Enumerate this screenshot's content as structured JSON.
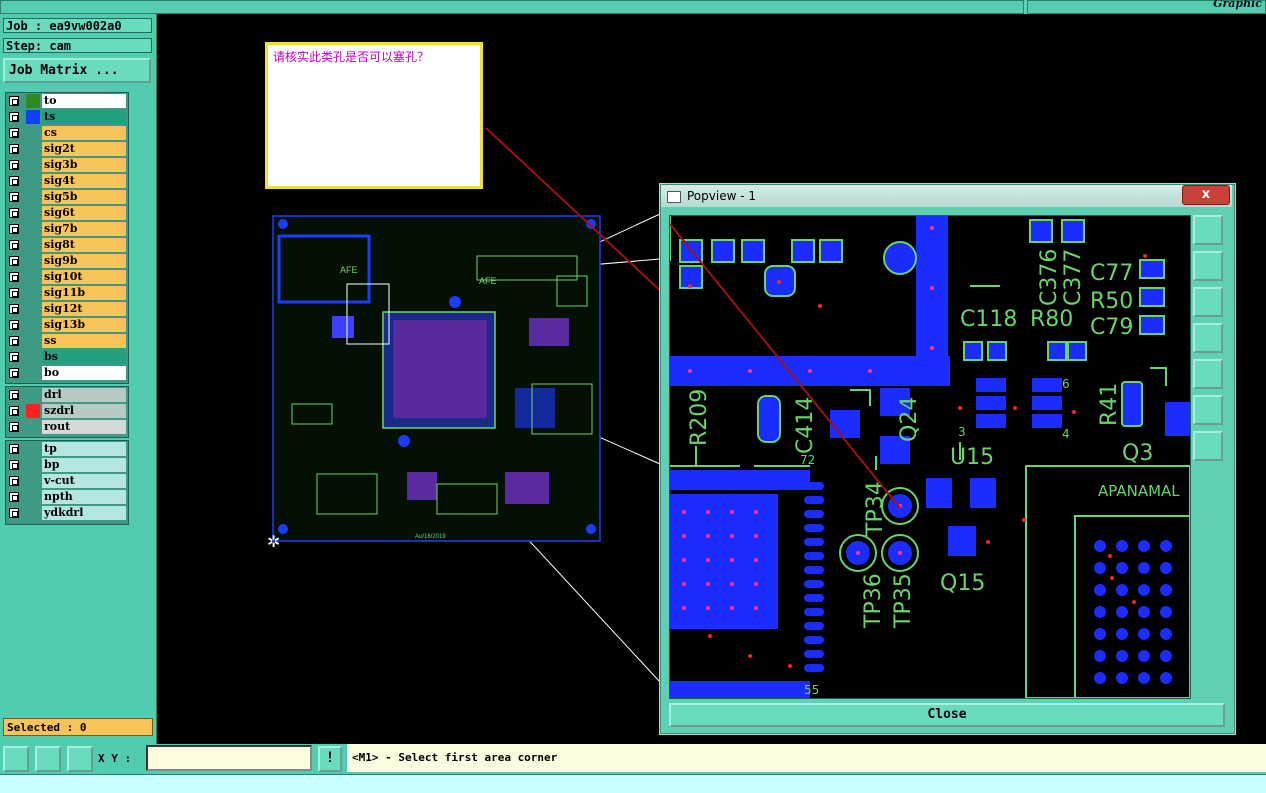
{
  "topbar": {
    "graphic_label": "Graphic"
  },
  "job": {
    "label": "Job : ea9vw002a0",
    "step": "Step: cam",
    "matrix_button": "Job Matrix ..."
  },
  "layers": {
    "group1": [
      {
        "name": "to",
        "color": "#ffffff",
        "swatch": "#2e8b20"
      },
      {
        "name": "ts",
        "color": "#23a07f",
        "swatch": "#1040ff"
      },
      {
        "name": "cs",
        "color": "#f8c45a",
        "swatch": ""
      },
      {
        "name": "sig2t",
        "color": "#f8c45a",
        "swatch": ""
      },
      {
        "name": "sig3b",
        "color": "#f8c45a",
        "swatch": ""
      },
      {
        "name": "sig4t",
        "color": "#f8c45a",
        "swatch": ""
      },
      {
        "name": "sig5b",
        "color": "#f8c45a",
        "swatch": ""
      },
      {
        "name": "sig6t",
        "color": "#f8c45a",
        "swatch": ""
      },
      {
        "name": "sig7b",
        "color": "#f8c45a",
        "swatch": ""
      },
      {
        "name": "sig8t",
        "color": "#f8c45a",
        "swatch": ""
      },
      {
        "name": "sig9b",
        "color": "#f8c45a",
        "swatch": ""
      },
      {
        "name": "sig10t",
        "color": "#f8c45a",
        "swatch": ""
      },
      {
        "name": "sig11b",
        "color": "#f8c45a",
        "swatch": ""
      },
      {
        "name": "sig12t",
        "color": "#f8c45a",
        "swatch": ""
      },
      {
        "name": "sig13b",
        "color": "#f8c45a",
        "swatch": ""
      },
      {
        "name": "ss",
        "color": "#f8c45a",
        "swatch": ""
      },
      {
        "name": "bs",
        "color": "#23a07f",
        "swatch": ""
      },
      {
        "name": "bo",
        "color": "#ffffff",
        "swatch": ""
      }
    ],
    "group2": [
      {
        "name": "drl",
        "color": "#b9c9c5",
        "swatch": ""
      },
      {
        "name": "szdrl",
        "color": "#b9c9c5",
        "swatch": "#ff2020"
      },
      {
        "name": "rout",
        "color": "#d8d8d8",
        "swatch": ""
      }
    ],
    "group3": [
      {
        "name": "tp",
        "color": "#b6e6e2",
        "swatch": ""
      },
      {
        "name": "bp",
        "color": "#b6e6e2",
        "swatch": ""
      },
      {
        "name": "v-cut",
        "color": "#b6e6e2",
        "swatch": ""
      },
      {
        "name": "npth",
        "color": "#b6e6e2",
        "swatch": ""
      },
      {
        "name": "ydkdrl",
        "color": "#b6e6e2",
        "swatch": ""
      }
    ]
  },
  "selected": "Selected : 0",
  "note": {
    "text": "请核实此类孔是否可以塞孔？"
  },
  "popview": {
    "title": "Popview - 1",
    "close_x": "x",
    "close_button": "Close",
    "designators": [
      "C376",
      "C377",
      "C77",
      "R50",
      "C79",
      "C118",
      "R80",
      "R209",
      "C414",
      "Q24",
      "U15",
      "R41",
      "Q3",
      "TP34",
      "TP36",
      "TP35",
      "Q15",
      "APANAMAL",
      "72",
      "55",
      "6",
      "4",
      "3"
    ]
  },
  "board": {
    "label1": "AFE",
    "label2": "AFE",
    "date": "Au/16/2019"
  },
  "bottombar": {
    "xy_label": "X Y :",
    "status": "<M1> - Select first area corner",
    "alert": "!"
  }
}
